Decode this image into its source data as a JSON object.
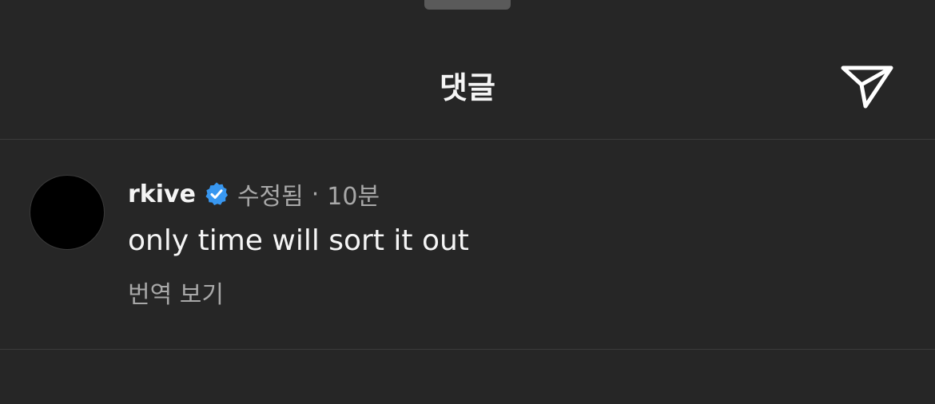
{
  "header": {
    "title": "댓글"
  },
  "comment": {
    "username": "rkive",
    "edited_label": "수정됨",
    "separator": "·",
    "time": "10분",
    "text": "only time will sort it out",
    "translate_label": "번역 보기"
  },
  "colors": {
    "background": "#262626",
    "verified_badge": "#3897f0",
    "secondary_text": "#a8a8a8"
  },
  "icons": {
    "share": "paper-plane-icon",
    "verified": "verified-badge-icon"
  }
}
